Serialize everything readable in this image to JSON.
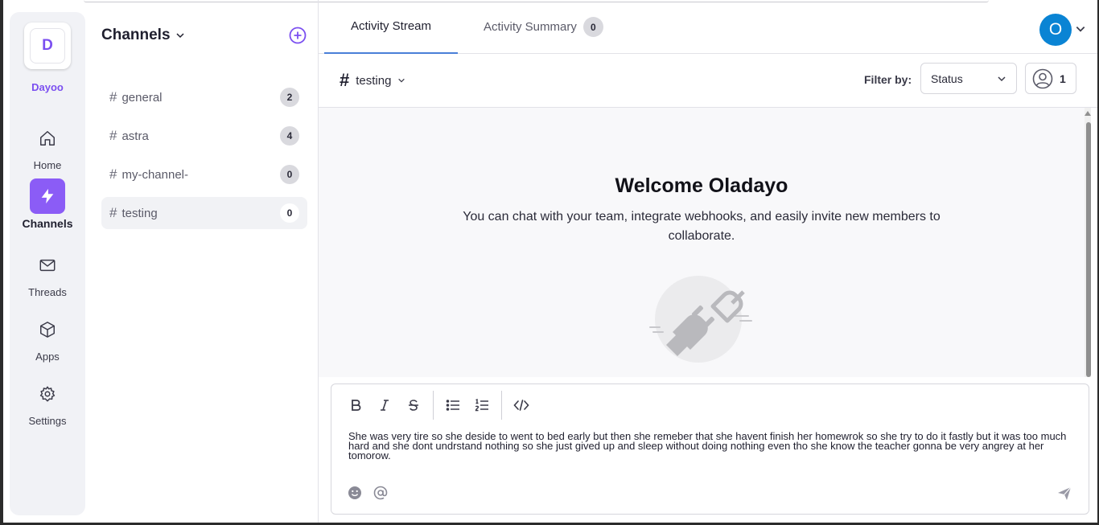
{
  "workspace": {
    "initial": "D",
    "name": "Dayoo"
  },
  "nav": [
    {
      "id": "home",
      "label": "Home",
      "icon": "home-icon"
    },
    {
      "id": "channels",
      "label": "Channels",
      "icon": "lightning-icon",
      "active": true
    },
    {
      "id": "threads",
      "label": "Threads",
      "icon": "mail-icon"
    },
    {
      "id": "apps",
      "label": "Apps",
      "icon": "cube-icon"
    },
    {
      "id": "settings",
      "label": "Settings",
      "icon": "gear-icon"
    }
  ],
  "channels_panel": {
    "title": "Channels",
    "items": [
      {
        "name": "general",
        "count": "2"
      },
      {
        "name": "astra",
        "count": "4"
      },
      {
        "name": "my-channel-",
        "count": "0"
      },
      {
        "name": "testing",
        "count": "0",
        "active": true
      }
    ]
  },
  "tabs": [
    {
      "label": "Activity Stream",
      "active": true
    },
    {
      "label": "Activity Summary",
      "badge": "0"
    }
  ],
  "user": {
    "initial": "O"
  },
  "subbar": {
    "channel": "testing",
    "filter_label": "Filter by:",
    "status_value": "Status",
    "members_count": "1"
  },
  "welcome": {
    "title": "Welcome Oladayo",
    "subtitle": "You can chat with your team, integrate webhooks, and easily invite new members to collaborate."
  },
  "composer": {
    "message": "She was very tire so she deside to went to bed early but then she remeber that she havent finish her homewrok so she try to do it fastly but it was too much hard and she dont undrstand nothing so she just gived up and sleep without doing nothing even tho she know the teacher gonna be very angrey at her tomorow."
  },
  "colors": {
    "accent": "#8b5cf6",
    "avatar": "#0a84d4",
    "tab_underline": "#4a7fd8"
  }
}
